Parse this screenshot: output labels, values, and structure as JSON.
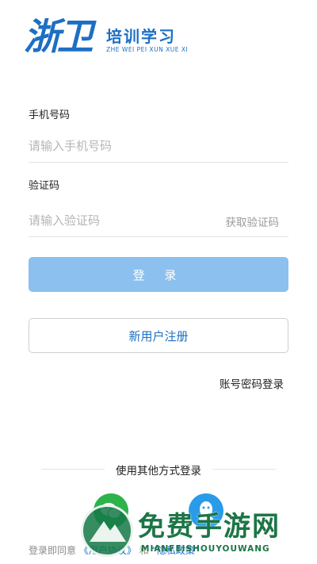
{
  "logo": {
    "mark": "浙卫",
    "title": "培训学习",
    "subtitle": "ZHE WEI PEI XUN XUE XI"
  },
  "phone": {
    "label": "手机号码",
    "placeholder": "请输入手机号码"
  },
  "code": {
    "label": "验证码",
    "placeholder": "请输入验证码",
    "get_code": "获取验证码"
  },
  "buttons": {
    "login": "登 录",
    "register": "新用户注册",
    "password_login": "账号密码登录"
  },
  "other_login": {
    "title": "使用其他方式登录",
    "icons": [
      "wechat-icon",
      "qq-icon"
    ]
  },
  "agreement": {
    "prefix": "登录即同意",
    "user_agreement": "《用户协议》",
    "and": "和",
    "privacy": "“隐私政策”"
  },
  "watermark": {
    "text": "免费手游网",
    "sub": "MIANFEISHOUYOUWANG"
  },
  "colors": {
    "brand": "#1d6fc4",
    "login_button": "#8cc0ee",
    "wechat": "#2db34a",
    "qq": "#2a9be8"
  }
}
